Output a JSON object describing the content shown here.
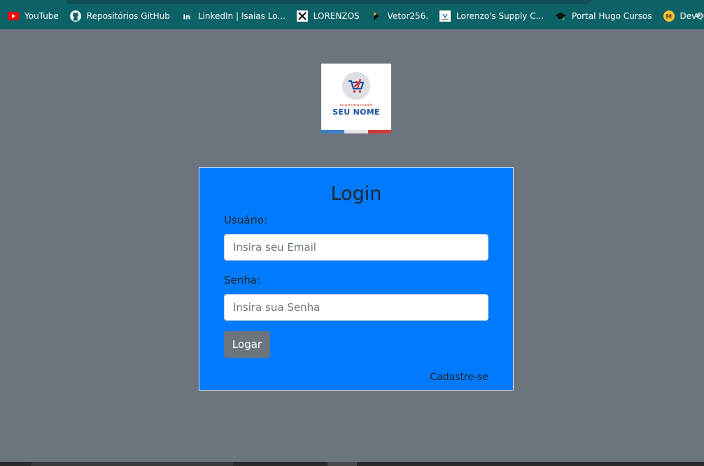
{
  "bookmarks": [
    {
      "label": "YouTube",
      "icon": "youtube-icon"
    },
    {
      "label": "Repositórios GitHub",
      "icon": "github-icon"
    },
    {
      "label": "LinkedIn | Isaias Lo...",
      "icon": "linkedin-icon"
    },
    {
      "label": "LORENZOS",
      "icon": "tools-icon"
    },
    {
      "label": "Vetor256.",
      "icon": "vetor-icon"
    },
    {
      "label": "Lorenzo's Supply C...",
      "icon": "supply-icon"
    },
    {
      "label": "Portal Hugo Cursos",
      "icon": "graduation-cap-icon"
    },
    {
      "label": "DevQuest",
      "icon": "devquest-icon"
    }
  ],
  "bookmarks_more": "»",
  "logo": {
    "small_text": "supermercado",
    "big_text": "SEU NOME",
    "stripe_colors": [
      "#3b82c4",
      "#e6e6e6",
      "#d23a3a"
    ]
  },
  "login": {
    "title": "Login",
    "user_label": "Usuário:",
    "user_placeholder": "Insira seu Email",
    "password_label": "Senha:",
    "password_placeholder": "Insira sua Senha",
    "submit_label": "Logar",
    "register_link": "Cadastre-se"
  },
  "colors": {
    "page_background": "#6c757d",
    "bookmarks_bar": "#0c6267",
    "login_box": "#007bff",
    "button": "#6c757d"
  }
}
